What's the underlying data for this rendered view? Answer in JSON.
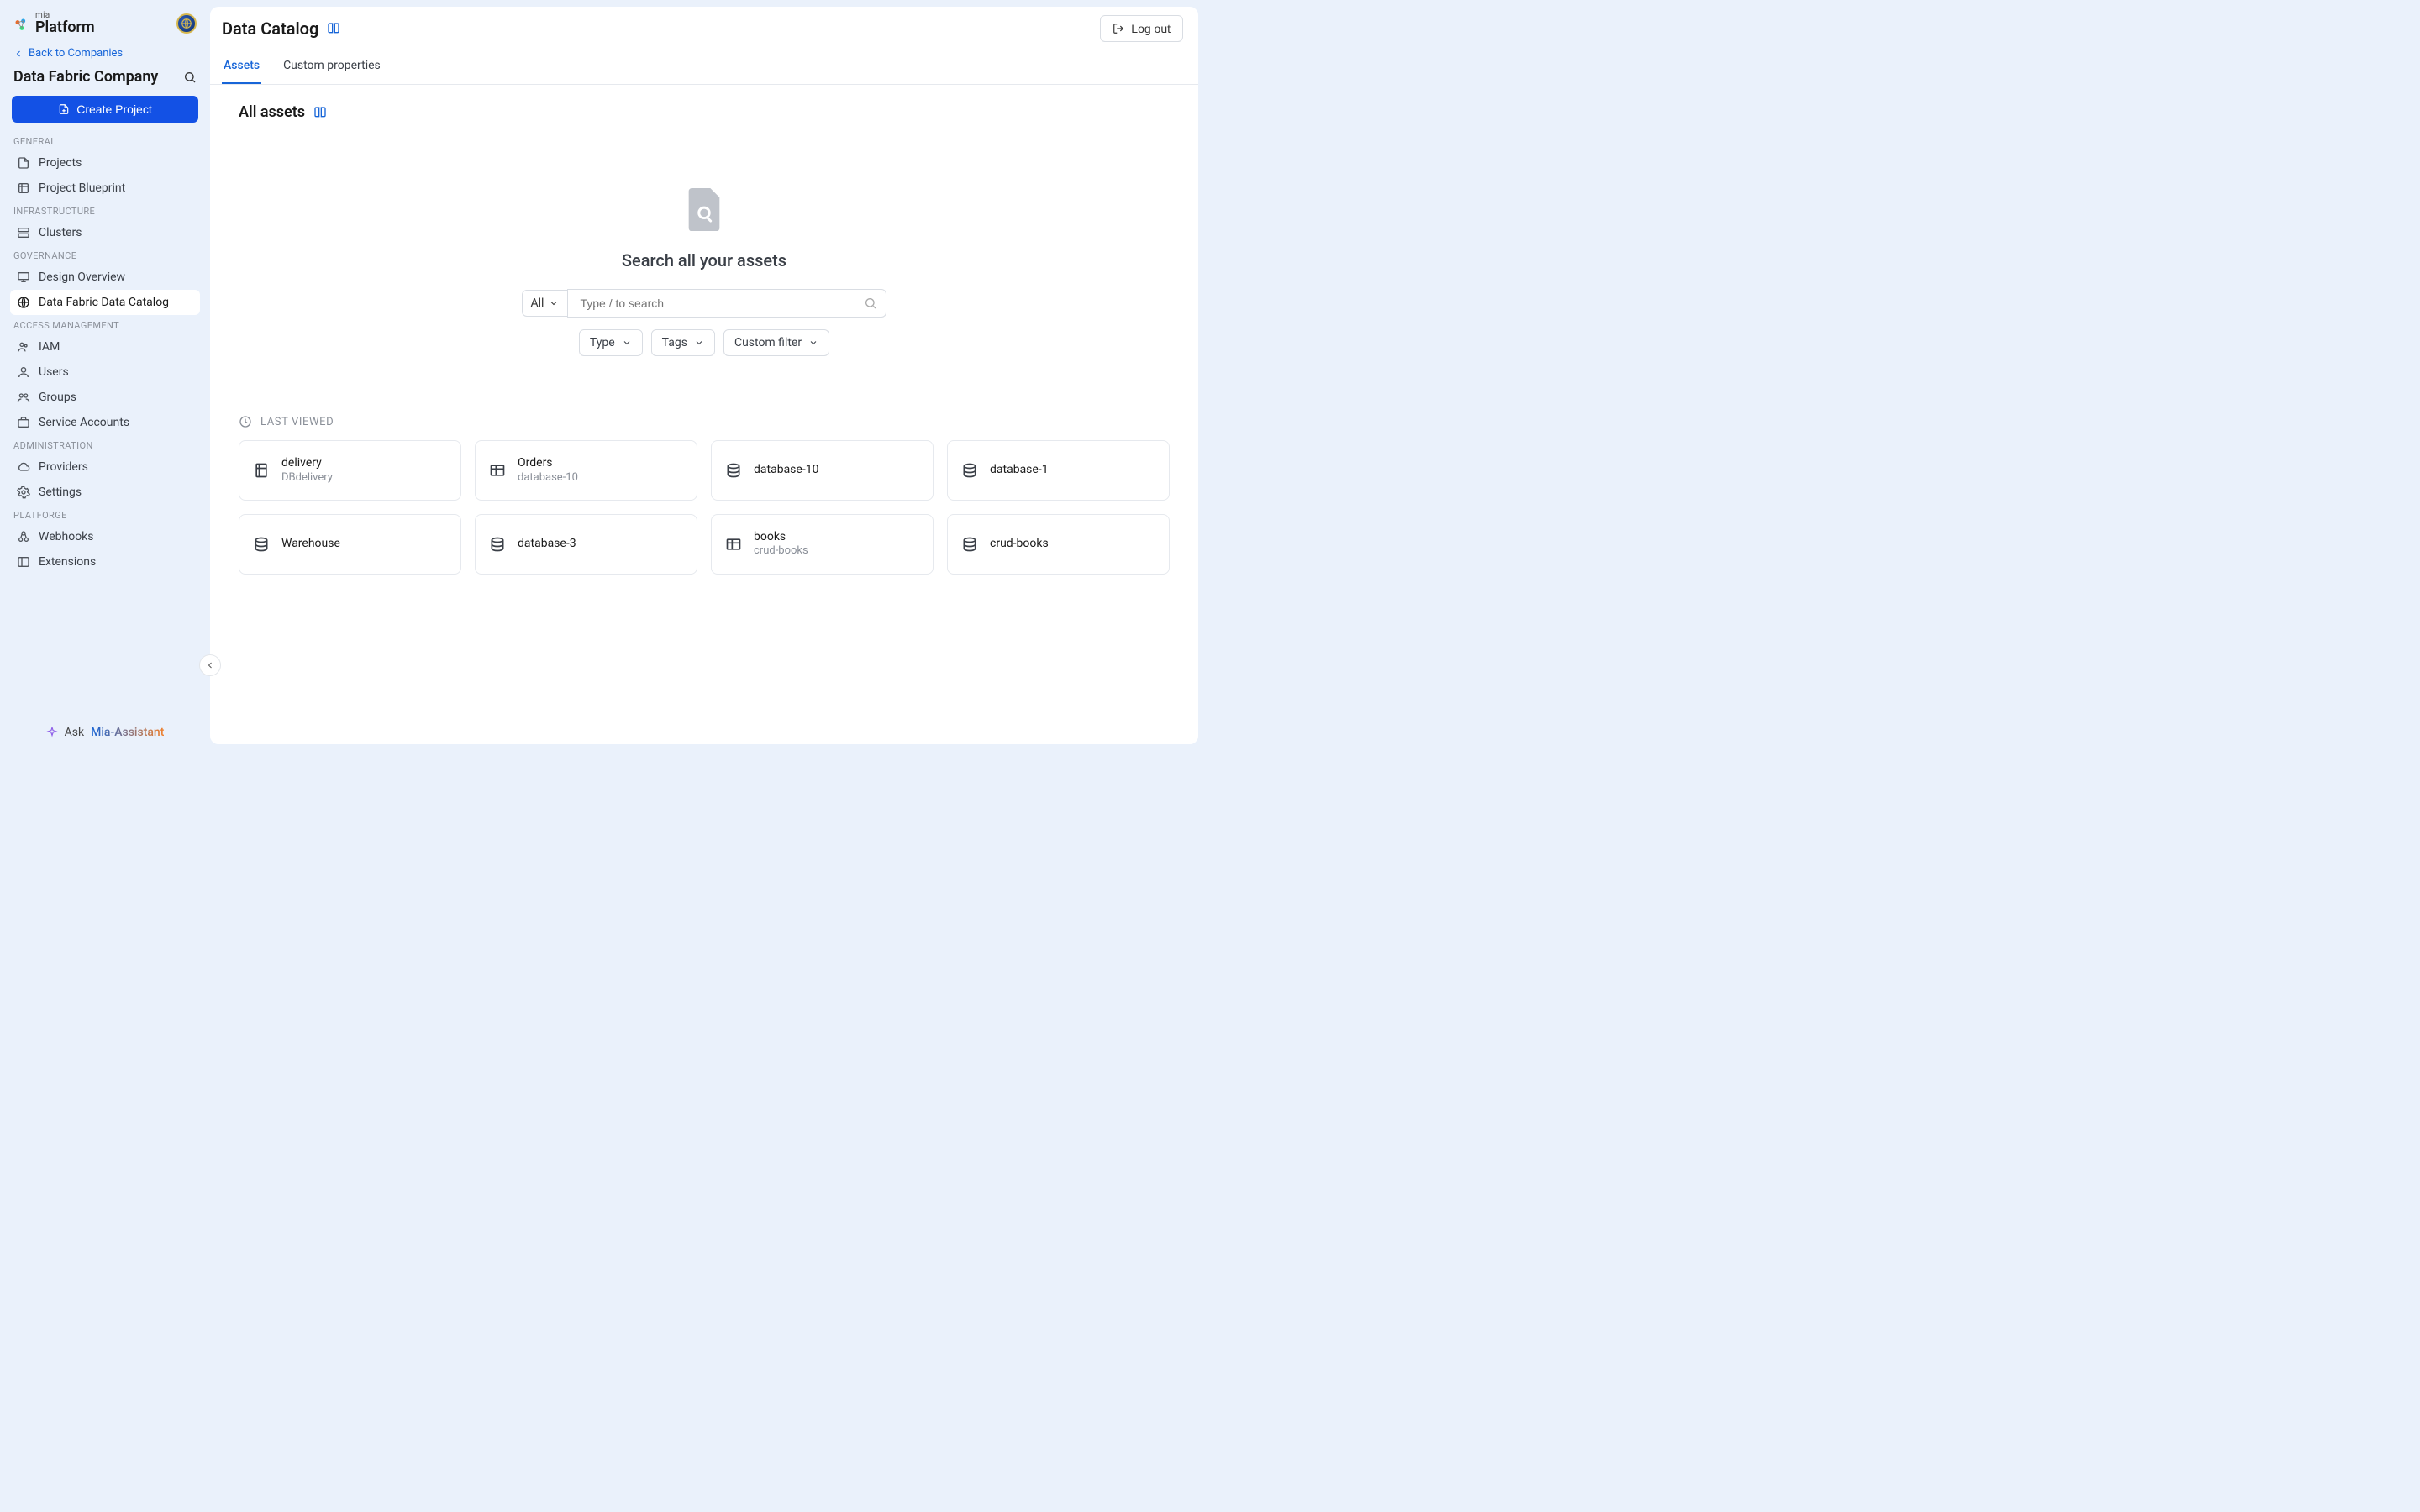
{
  "brand": {
    "sup": "mia",
    "name": "Platform"
  },
  "sidebar": {
    "back": "Back to Companies",
    "company": "Data Fabric Company",
    "create": "Create Project",
    "sections": {
      "general": "GENERAL",
      "infrastructure": "INFRASTRUCTURE",
      "governance": "GOVERNANCE",
      "access": "ACCESS MANAGEMENT",
      "admin": "ADMINISTRATION",
      "platforge": "PLATFORGE"
    },
    "items": {
      "projects": "Projects",
      "blueprint": "Project Blueprint",
      "clusters": "Clusters",
      "design": "Design Overview",
      "catalog": "Data Fabric Data Catalog",
      "iam": "IAM",
      "users": "Users",
      "groups": "Groups",
      "service_accounts": "Service Accounts",
      "providers": "Providers",
      "settings": "Settings",
      "webhooks": "Webhooks",
      "extensions": "Extensions"
    },
    "assistant": {
      "ask": "Ask",
      "name": "Mia-Assistant"
    }
  },
  "header": {
    "title": "Data Catalog",
    "logout": "Log out"
  },
  "tabs": {
    "assets": "Assets",
    "custom": "Custom properties"
  },
  "assets": {
    "sub_title": "All assets",
    "hero_title": "Search all your assets",
    "select": "All",
    "placeholder": "Type / to search",
    "filters": {
      "type": "Type",
      "tags": "Tags",
      "custom": "Custom filter"
    },
    "last_viewed": "LAST VIEWED",
    "cards": [
      {
        "title": "delivery",
        "sub": "DBdelivery",
        "icon": "sheet"
      },
      {
        "title": "Orders",
        "sub": "database-10",
        "icon": "table"
      },
      {
        "title": "database-10",
        "sub": "",
        "icon": "db"
      },
      {
        "title": "database-1",
        "sub": "",
        "icon": "db"
      },
      {
        "title": "Warehouse",
        "sub": "",
        "icon": "db"
      },
      {
        "title": "database-3",
        "sub": "",
        "icon": "db"
      },
      {
        "title": "books",
        "sub": "crud-books",
        "icon": "table"
      },
      {
        "title": "crud-books",
        "sub": "",
        "icon": "db"
      }
    ]
  }
}
